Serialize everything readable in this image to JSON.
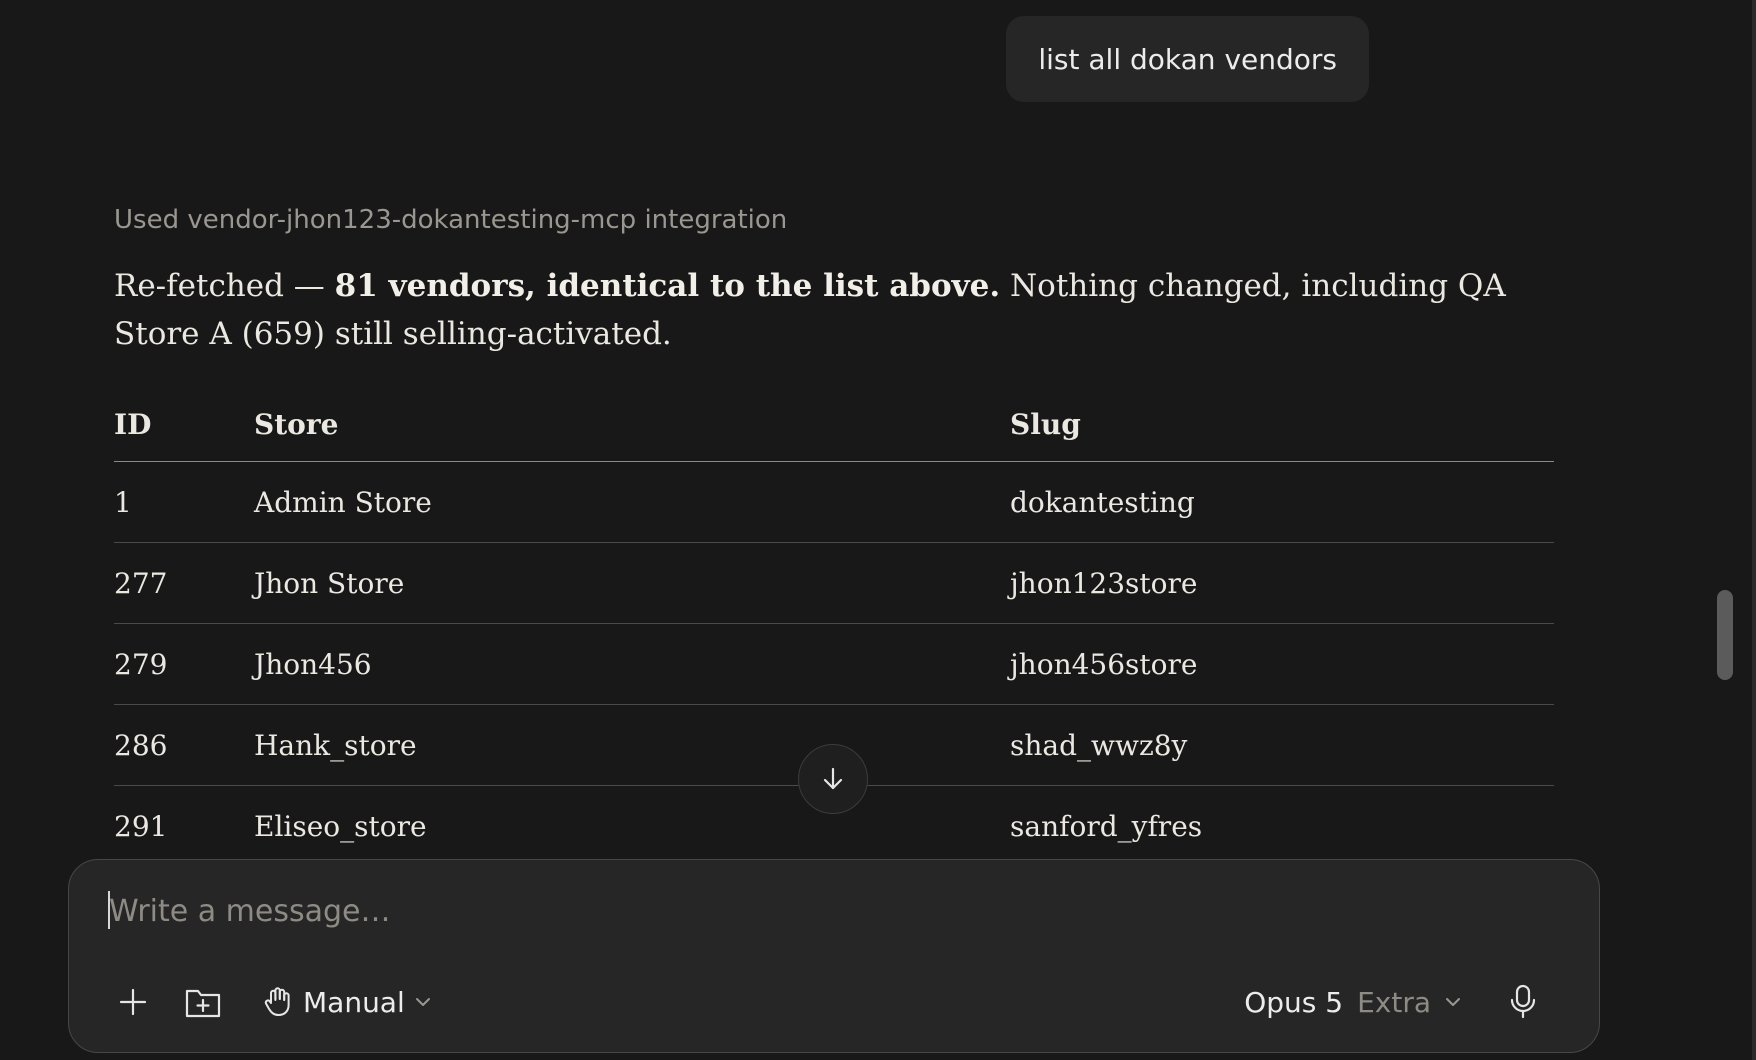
{
  "user_message": "list all dokan vendors",
  "tool_notice": "Used vendor-jhon123-dokantesting-mcp integration",
  "reply": {
    "lead": "Re-fetched — ",
    "bold": "81 vendors, identical to the list above.",
    "rest": " Nothing changed, including QA Store A (659) still selling-activated."
  },
  "table": {
    "headers": [
      "ID",
      "Store",
      "Slug"
    ],
    "rows": [
      [
        "1",
        "Admin Store",
        "dokantesting"
      ],
      [
        "277",
        "Jhon Store",
        "jhon123store"
      ],
      [
        "279",
        "Jhon456",
        "jhon456store"
      ],
      [
        "286",
        "Hank_store",
        "shad_wwz8y"
      ],
      [
        "291",
        "Eliseo_store",
        "sanford_yfres"
      ]
    ]
  },
  "composer": {
    "placeholder": "Write a message…",
    "mode_label": "Manual",
    "model_name": "Opus 5",
    "model_effort": "Extra"
  },
  "icons": {
    "scroll": "arrow-down-icon",
    "add": "plus-icon",
    "folder": "folder-plus-icon",
    "mode": "hand-icon",
    "chevron": "chevron-down-icon",
    "mic": "microphone-icon"
  },
  "colors": {
    "background": "#181818",
    "bubble": "#262626",
    "text": "#ebe8e1",
    "muted": "#9a9790"
  }
}
